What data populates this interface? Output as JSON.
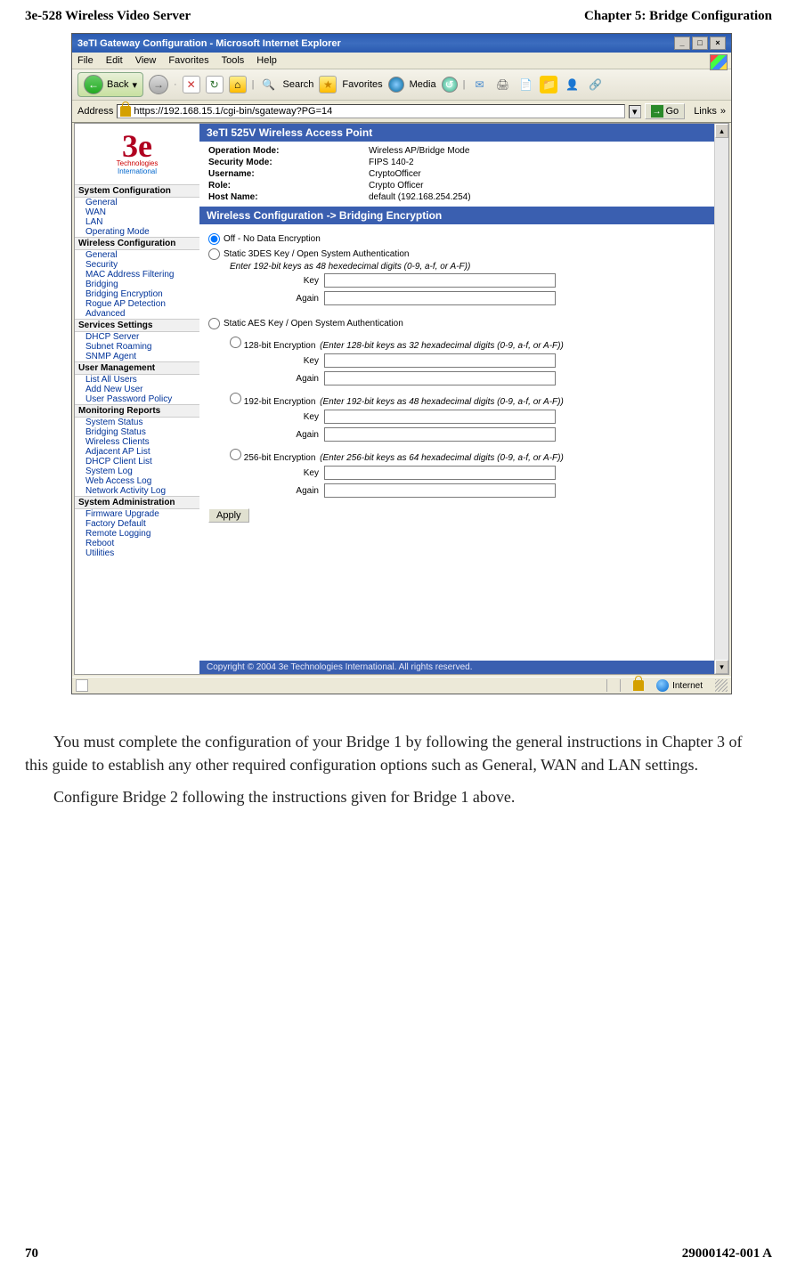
{
  "header": {
    "left": "3e-528 Wireless Video Server",
    "right": "Chapter 5: Bridge Configuration"
  },
  "footer": {
    "left": "70",
    "right": "29000142-001 A"
  },
  "ie": {
    "title": "3eTI Gateway Configuration - Microsoft Internet Explorer",
    "menu": [
      "File",
      "Edit",
      "View",
      "Favorites",
      "Tools",
      "Help"
    ],
    "back": "Back",
    "search": "Search",
    "favorites": "Favorites",
    "media": "Media",
    "addr_label": "Address",
    "url": "https://192.168.15.1/cgi-bin/sgateway?PG=14",
    "go": "Go",
    "links": "Links",
    "status_inet": "Internet"
  },
  "logo": {
    "brand": "3e",
    "tech": "Technologies",
    "intl": "International"
  },
  "nav": {
    "g1": "System Configuration",
    "g1_items": [
      "General",
      "WAN",
      "LAN",
      "Operating Mode"
    ],
    "g2": "Wireless Configuration",
    "g2_items": [
      "General",
      "Security",
      "MAC Address Filtering",
      "Bridging",
      "Bridging Encryption",
      "Rogue AP Detection",
      "Advanced"
    ],
    "g3": "Services Settings",
    "g3_items": [
      "DHCP Server",
      "Subnet Roaming",
      "SNMP Agent"
    ],
    "g4": "User Management",
    "g4_items": [
      "List All Users",
      "Add New User",
      "User Password Policy"
    ],
    "g5": "Monitoring Reports",
    "g5_items": [
      "System Status",
      "Bridging Status",
      "Wireless Clients",
      "Adjacent AP List",
      "DHCP Client List",
      "System Log",
      "Web Access Log",
      "Network Activity Log"
    ],
    "g6": "System Administration",
    "g6_items": [
      "Firmware Upgrade",
      "Factory Default",
      "Remote Logging",
      "Reboot",
      "Utilities"
    ]
  },
  "top_title": "3eTI 525V Wireless Access Point",
  "info": {
    "op_lbl": "Operation Mode:",
    "op_val": "Wireless AP/Bridge Mode",
    "sec_lbl": "Security Mode:",
    "sec_val": "FIPS 140-2",
    "user_lbl": "Username:",
    "user_val": "CryptoOfficer",
    "role_lbl": "Role:",
    "role_val": "Crypto Officer",
    "host_lbl": "Host Name:",
    "host_val": "default (192.168.254.254)"
  },
  "section_title": "Wireless Configuration -> Bridging Encryption",
  "form": {
    "off": "Off - No Data Encryption",
    "des": "Static 3DES Key / Open System Authentication",
    "des_hint": "Enter 192-bit keys as 48 hexedecimal digits (0-9, a-f, or A-F))",
    "aes": "Static AES Key / Open System Authentication",
    "aes128": "128-bit Encryption",
    "aes128_hint": "(Enter 128-bit keys as 32 hexadecimal digits (0-9, a-f, or A-F))",
    "aes192": "192-bit Encryption",
    "aes192_hint": "(Enter 192-bit keys as 48 hexadecimal digits (0-9, a-f, or A-F))",
    "aes256": "256-bit Encryption",
    "aes256_hint": "(Enter 256-bit keys as 64 hexadecimal digits (0-9, a-f, or A-F))",
    "key": "Key",
    "again": "Again",
    "apply": "Apply"
  },
  "copyright": "Copyright © 2004 3e Technologies International. All rights reserved.",
  "para1": "You must complete the configuration of your Bridge 1 by following the general instructions in Chapter 3 of this guide to establish any other required configuration options such as General, WAN and LAN settings.",
  "para2": "Configure Bridge 2 following the instructions given for Bridge 1 above."
}
